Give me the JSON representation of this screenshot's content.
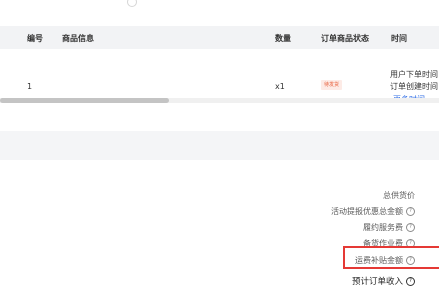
{
  "table": {
    "headers": {
      "index": "编号",
      "product_info": "商品信息",
      "quantity": "数量",
      "item_status": "订单商品状态",
      "time": "时间"
    },
    "rows": [
      {
        "index": "1",
        "quantity": "x1",
        "status": "待发货",
        "time_lines": [
          "用户下单时间",
          "订单创建时间"
        ],
        "more_time": "更多时间"
      }
    ]
  },
  "summary": {
    "total_price": "总供货价",
    "activity_discount": "活动提报优惠总金额",
    "fulfillment_fee": "履约服务费",
    "stock_prep_fee": "备货作业费",
    "shipping_subsidy": "运费补贴金额",
    "expected_income": "预计订单收入"
  },
  "icons": {
    "help": "question-circle-icon"
  },
  "colors": {
    "link": "#2f6de6",
    "status_tag": "#e8603c",
    "highlight": "#e53935"
  }
}
